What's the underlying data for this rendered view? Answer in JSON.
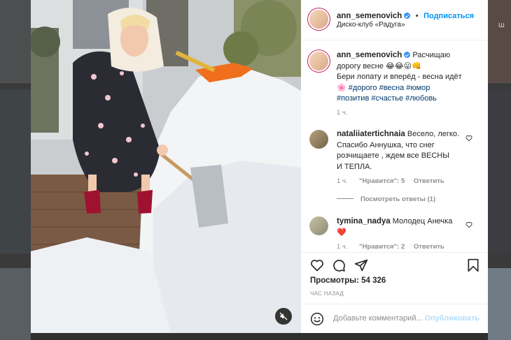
{
  "post": {
    "username": "ann_semenovich",
    "follow_label": "Подписаться",
    "location": "Диско-клуб «Радуга»",
    "more_label": "•••"
  },
  "caption": {
    "username": "ann_semenovich",
    "line1": "Расчищаю",
    "line2": "дорогу весне 😂😂😛👊",
    "line3": "Бери лопату и вперёд - весна идёт",
    "line4_emoji": "🌸",
    "tags1": "#дорого #весна #юмор",
    "tags2": "#позитив #счастье #любовь",
    "time": "1 ч."
  },
  "comments": [
    {
      "username": "nataliiatertichnaia",
      "lines": [
        "Весело, легко.",
        "Спасибо Аннушка, что снег",
        "розчищаете , ждем все ВЕСНЫ",
        "И ТЕПЛА."
      ],
      "time": "1 ч.",
      "likes": "\"Нравится\": 5",
      "reply": "Ответить",
      "view_replies": "Посмотреть ответы (1)"
    },
    {
      "username": "tymina_nadya",
      "text": "Молодец Анечка",
      "emoji": "❤️",
      "time": "1 ч.",
      "likes": "\"Нравится\": 2",
      "reply": "Ответить"
    }
  ],
  "footer": {
    "likes": "Просмотры: 54 326",
    "timestamp": "ЧАС НАЗАД",
    "comment_placeholder": "Добавьте комментарий...",
    "publish_label": "Опубликовать"
  },
  "background": {
    "right_edge_text": "ш"
  },
  "colors": {
    "follow_blue": "#0095f6",
    "heart_red": "#ed4956",
    "publish_disabled": "#b2dffc"
  },
  "icons": [
    "heart-icon",
    "comment-icon",
    "share-icon",
    "bookmark-icon",
    "emoji-icon",
    "mute-icon",
    "more-icon",
    "verified-icon"
  ]
}
